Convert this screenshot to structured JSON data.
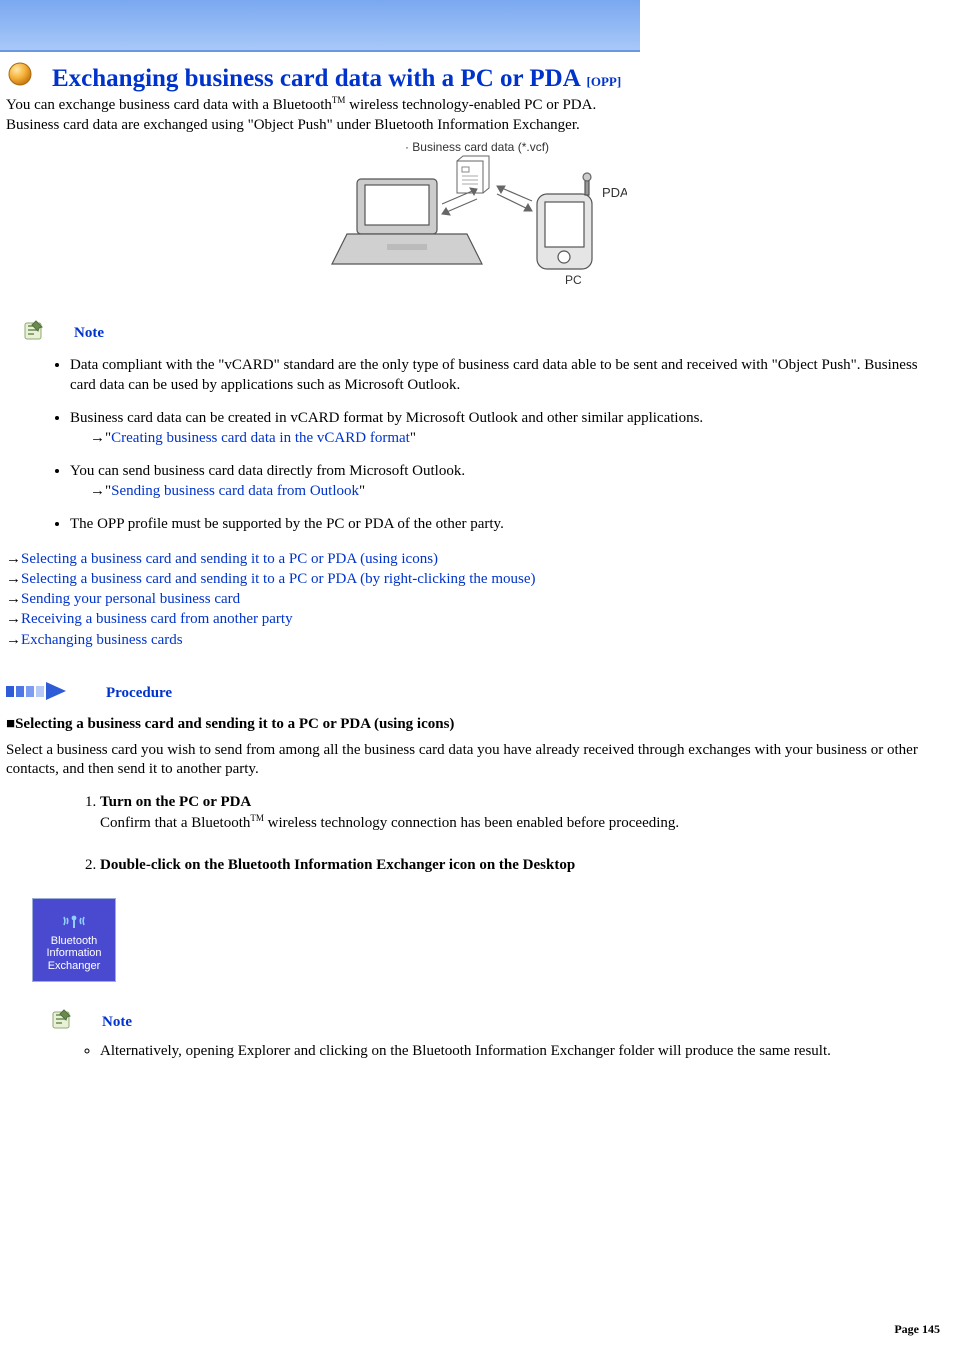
{
  "header": {
    "title": "Exchanging business card data with a PC or PDA",
    "suffix": "[OPP]"
  },
  "intro": {
    "line1": "You can exchange business card data with a Bluetooth",
    "line1_tm": "TM",
    "line1_tail": " wireless technology-enabled PC or PDA.",
    "line2": "Business card data are exchanged using \"Object Push\" under Bluetooth Information Exchanger."
  },
  "diagram": {
    "caption": "· Business card data (*.vcf)",
    "pda_label": "PDA",
    "pc_label": "PC"
  },
  "note_label": "Note",
  "note_items": [
    {
      "text": "Data compliant with the \"vCARD\" standard are the only type of business card data able to be sent and received with \"Object Push\". Business card data can be used by applications such as Microsoft Outlook."
    },
    {
      "text": "Business card data can be created in vCARD format by Microsoft Outlook and other similar applications.",
      "link_prefix": "→\"",
      "link": "Creating business card data in the vCARD format",
      "link_suffix": "\""
    },
    {
      "text": "You can send business card data directly from Microsoft Outlook.",
      "link_prefix": "→\"",
      "link": "Sending business card data from Outlook",
      "link_suffix": "\""
    },
    {
      "text": "The OPP profile must be supported by the PC or PDA of the other party."
    }
  ],
  "nav_links": [
    "Selecting a business card and sending it to a PC or PDA (using icons)",
    "Selecting a business card and sending it to a PC or PDA (by right-clicking the mouse)",
    "Sending your personal business card",
    "Receiving a business card from another party",
    "Exchanging business cards"
  ],
  "procedure_label": "Procedure",
  "section_heading": "Selecting a business card and sending it to a PC or PDA (using icons)",
  "section_intro": "Select a business card you wish to send from among all the business card data you have already received through exchanges with your business or other contacts, and then send it to another party.",
  "steps": [
    {
      "title": "Turn on the PC or PDA",
      "body_pre": "Confirm that a Bluetooth",
      "body_tm": "TM",
      "body_post": " wireless technology connection has been enabled before proceeding."
    },
    {
      "title": "Double-click on the Bluetooth Information Exchanger icon on the Desktop"
    }
  ],
  "bie_icon": {
    "line1": "Bluetooth",
    "line2": "Information",
    "line3": "Exchanger"
  },
  "sub_note_label": "Note",
  "sub_note_item": "Alternatively, opening Explorer and clicking on the Bluetooth Information Exchanger folder will produce the same result.",
  "page_footer": "Page 145"
}
